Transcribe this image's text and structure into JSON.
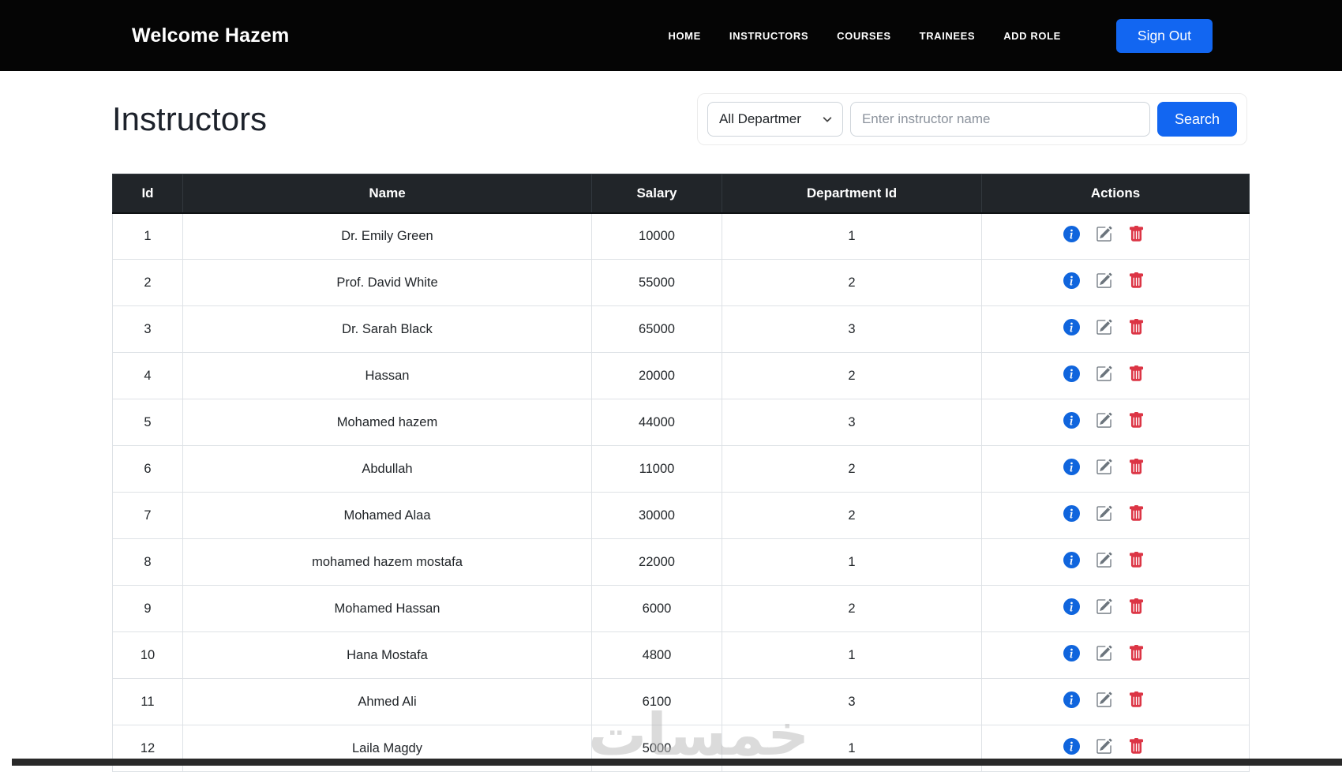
{
  "navbar": {
    "brand": "Welcome Hazem",
    "links": [
      "HOME",
      "INSTRUCTORS",
      "COURSES",
      "TRAINEES",
      "ADD ROLE"
    ],
    "sign_out_label": "Sign Out"
  },
  "page": {
    "title": "Instructors"
  },
  "filter": {
    "department_selected": "All Departmer",
    "name_placeholder": "Enter instructor name",
    "search_label": "Search"
  },
  "table": {
    "headers": [
      "Id",
      "Name",
      "Salary",
      "Department Id",
      "Actions"
    ],
    "rows": [
      {
        "id": "1",
        "name": "Dr. Emily Green",
        "salary": "10000",
        "department_id": "1"
      },
      {
        "id": "2",
        "name": "Prof. David White",
        "salary": "55000",
        "department_id": "2"
      },
      {
        "id": "3",
        "name": "Dr. Sarah Black",
        "salary": "65000",
        "department_id": "3"
      },
      {
        "id": "4",
        "name": "Hassan",
        "salary": "20000",
        "department_id": "2"
      },
      {
        "id": "5",
        "name": "Mohamed hazem",
        "salary": "44000",
        "department_id": "3"
      },
      {
        "id": "6",
        "name": "Abdullah",
        "salary": "11000",
        "department_id": "2"
      },
      {
        "id": "7",
        "name": "Mohamed Alaa",
        "salary": "30000",
        "department_id": "2"
      },
      {
        "id": "8",
        "name": "mohamed hazem mostafa",
        "salary": "22000",
        "department_id": "1"
      },
      {
        "id": "9",
        "name": "Mohamed Hassan",
        "salary": "6000",
        "department_id": "2"
      },
      {
        "id": "10",
        "name": "Hana Mostafa",
        "salary": "4800",
        "department_id": "1"
      },
      {
        "id": "11",
        "name": "Ahmed Ali",
        "salary": "6100",
        "department_id": "3"
      },
      {
        "id": "12",
        "name": "Laila Magdy",
        "salary": "5000",
        "department_id": "1"
      }
    ],
    "action_icons": [
      "info",
      "edit",
      "delete"
    ]
  },
  "watermark_text": "خمسات",
  "colors": {
    "primary_blue": "#1266f1",
    "info_icon_blue": "#1065dd",
    "edit_icon_gray": "#6c757d",
    "delete_icon_red": "#dc3545",
    "header_dark": "#212529",
    "navbar_black": "#050505"
  }
}
